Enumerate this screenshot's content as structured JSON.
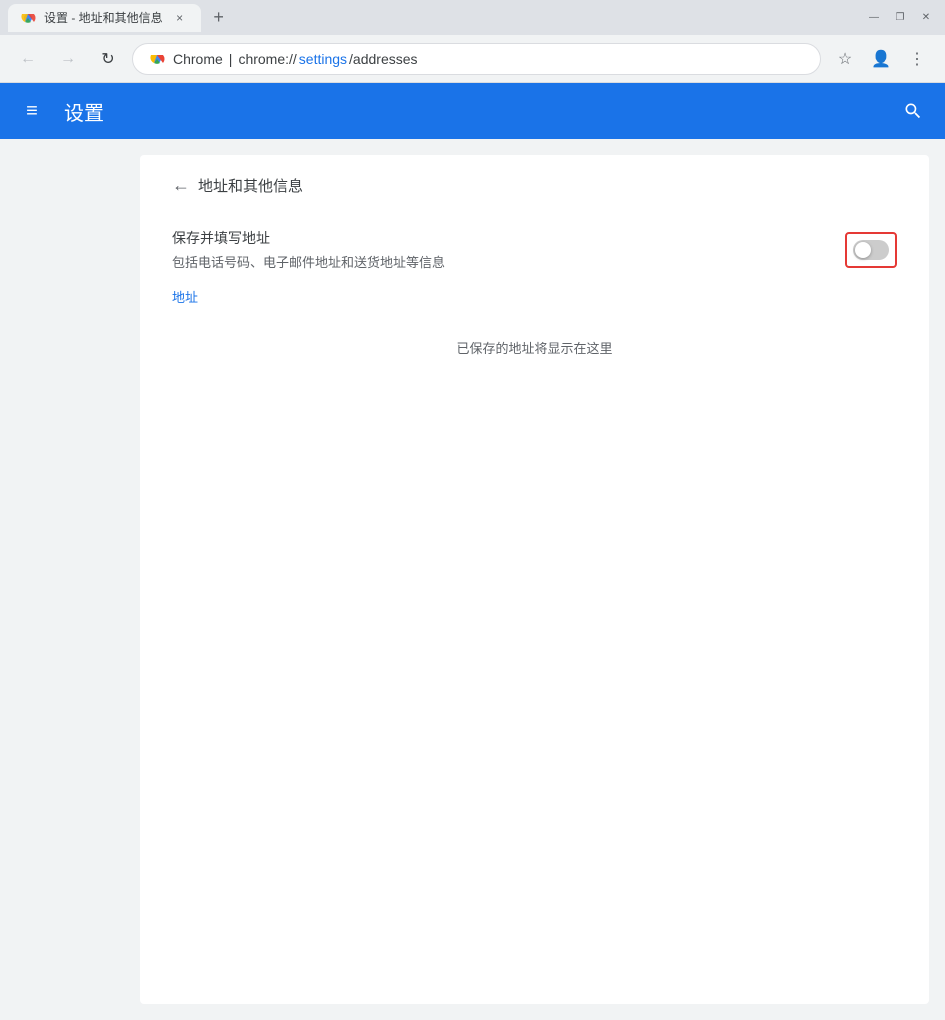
{
  "titlebar": {
    "tab_title": "设置 - 地址和其他信息",
    "tab_close": "×",
    "new_tab": "+",
    "ctrl_minimize": "—",
    "ctrl_restore": "❐",
    "ctrl_close": "✕"
  },
  "addressbar": {
    "back_label": "←",
    "forward_label": "→",
    "refresh_label": "↻",
    "url_prefix": "Chrome",
    "url_separator": "|",
    "url_scheme": "chrome://",
    "url_settings": "settings",
    "url_path": "/addresses",
    "bookmark_label": "☆",
    "account_label": "👤",
    "menu_label": "⋮"
  },
  "header": {
    "menu_icon": "≡",
    "title": "设置",
    "search_icon": "🔍"
  },
  "content": {
    "back_arrow": "←",
    "page_title": "地址和其他信息",
    "save_label": "保存并填写地址",
    "save_desc": "包括电话号码、电子邮件地址和送货地址等信息",
    "section_label": "地址",
    "empty_label": "已保存的地址将显示在这里"
  }
}
